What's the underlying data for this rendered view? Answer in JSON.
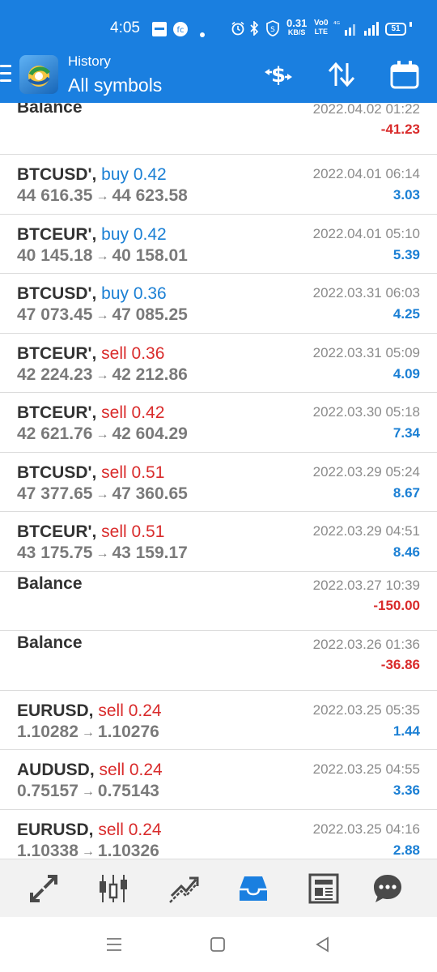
{
  "status_bar": {
    "time": "4:05",
    "net_speed_value": "0.31",
    "net_speed_unit": "KB/S",
    "volte_top": "Vo0",
    "volte_bottom": "LTE",
    "signal_label": "4G",
    "battery": "51"
  },
  "app_bar": {
    "title": "History",
    "subtitle": "All symbols"
  },
  "history": {
    "rows": [
      {
        "kind": "balance",
        "symbol": "Balance",
        "date": "2022.04.02 01:22",
        "profit": "-41.23",
        "profit_sign": "neg"
      },
      {
        "kind": "deal",
        "symbol": "BTCUSD',",
        "side": "buy 0.42",
        "side_color": "buy",
        "open": "44 616.35",
        "close": "44 623.58",
        "date": "2022.04.01 06:14",
        "profit": "3.03",
        "profit_sign": "pos"
      },
      {
        "kind": "deal",
        "symbol": "BTCEUR',",
        "side": "buy 0.42",
        "side_color": "buy",
        "open": "40 145.18",
        "close": "40 158.01",
        "date": "2022.04.01 05:10",
        "profit": "5.39",
        "profit_sign": "pos"
      },
      {
        "kind": "deal",
        "symbol": "BTCUSD',",
        "side": "buy 0.36",
        "side_color": "buy",
        "open": "47 073.45",
        "close": "47 085.25",
        "date": "2022.03.31 06:03",
        "profit": "4.25",
        "profit_sign": "pos"
      },
      {
        "kind": "deal",
        "symbol": "BTCEUR',",
        "side": "sell 0.36",
        "side_color": "sell",
        "open": "42 224.23",
        "close": "42 212.86",
        "date": "2022.03.31 05:09",
        "profit": "4.09",
        "profit_sign": "pos"
      },
      {
        "kind": "deal",
        "symbol": "BTCEUR',",
        "side": "sell 0.42",
        "side_color": "sell",
        "open": "42 621.76",
        "close": "42 604.29",
        "date": "2022.03.30 05:18",
        "profit": "7.34",
        "profit_sign": "pos"
      },
      {
        "kind": "deal",
        "symbol": "BTCUSD',",
        "side": "sell 0.51",
        "side_color": "sell",
        "open": "47 377.65",
        "close": "47 360.65",
        "date": "2022.03.29 05:24",
        "profit": "8.67",
        "profit_sign": "pos"
      },
      {
        "kind": "deal",
        "symbol": "BTCEUR',",
        "side": "sell 0.51",
        "side_color": "sell",
        "open": "43 175.75",
        "close": "43 159.17",
        "date": "2022.03.29 04:51",
        "profit": "8.46",
        "profit_sign": "pos"
      },
      {
        "kind": "balance",
        "symbol": "Balance",
        "date": "2022.03.27 10:39",
        "profit": "-150.00",
        "profit_sign": "neg"
      },
      {
        "kind": "balance",
        "symbol": "Balance",
        "date": "2022.03.26 01:36",
        "profit": "-36.86",
        "profit_sign": "neg"
      },
      {
        "kind": "deal",
        "symbol": "EURUSD,",
        "side": "sell 0.24",
        "side_color": "sell",
        "open": "1.10282",
        "close": "1.10276",
        "date": "2022.03.25 05:35",
        "profit": "1.44",
        "profit_sign": "pos"
      },
      {
        "kind": "deal",
        "symbol": "AUDUSD,",
        "side": "sell 0.24",
        "side_color": "sell",
        "open": "0.75157",
        "close": "0.75143",
        "date": "2022.03.25 04:55",
        "profit": "3.36",
        "profit_sign": "pos"
      },
      {
        "kind": "deal",
        "symbol": "EURUSD,",
        "side": "sell 0.24",
        "side_color": "sell",
        "open": "1.10338",
        "close": "1.10326",
        "date": "2022.03.25 04:16",
        "profit": "2.88",
        "profit_sign": "pos"
      }
    ]
  },
  "bottom_nav": {
    "items": [
      {
        "icon": "quotes-icon"
      },
      {
        "icon": "chart-icon"
      },
      {
        "icon": "trade-icon"
      },
      {
        "icon": "history-icon",
        "active": true
      },
      {
        "icon": "news-icon"
      },
      {
        "icon": "messages-icon"
      }
    ]
  },
  "colors": {
    "brand_blue": "#1a7fe0",
    "buy_blue": "#1a7fd4",
    "sell_red": "#d92b2b",
    "nav_icon": "#4a4a4a"
  }
}
